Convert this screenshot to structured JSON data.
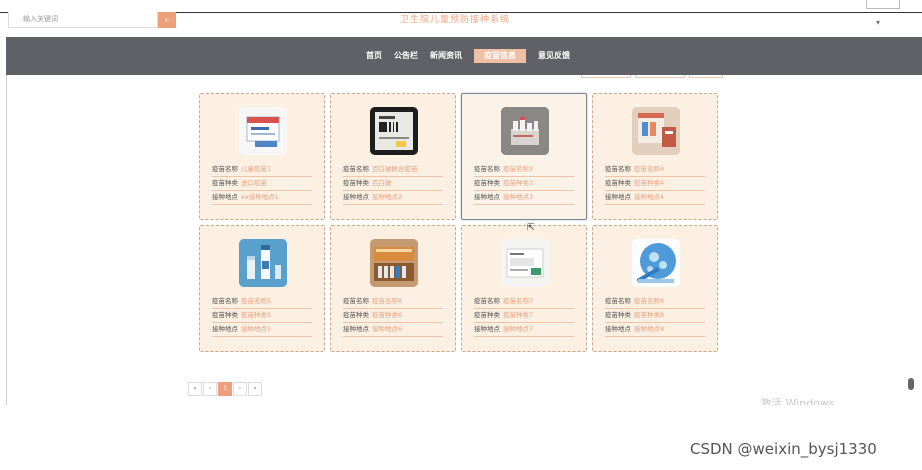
{
  "header": {
    "search_placeholder": "输入关键词",
    "search_button": "搜",
    "site_title": "卫生院儿童预防接种系统"
  },
  "nav": {
    "items": [
      "首页",
      "公告栏",
      "新闻资讯",
      "疫苗信息",
      "意见反馈"
    ],
    "active_index": 3
  },
  "labels": {
    "name": "疫苗名称",
    "type": "疫苗种类",
    "place": "接种地点"
  },
  "cards": [
    {
      "name": "儿童疫苗1",
      "type": "进口疫苗",
      "place": "xx接种地点1",
      "image": "vaccine-box-image"
    },
    {
      "name": "百白破联合疫苗",
      "type": "百白破",
      "place": "接种地点2",
      "image": "vaccine-tablet-image"
    },
    {
      "name": "疫苗名称3",
      "type": "疫苗种类3",
      "place": "接种地点3",
      "image": "vaccine-vials-image"
    },
    {
      "name": "疫苗名称4",
      "type": "疫苗种类4",
      "place": "接种地点4",
      "image": "vaccine-kit-image"
    },
    {
      "name": "疫苗名称5",
      "type": "疫苗种类5",
      "place": "接种地点5",
      "image": "vaccine-bottle-image"
    },
    {
      "name": "疫苗名称6",
      "type": "疫苗种类6",
      "place": "接种地点6",
      "image": "vaccine-tray-image"
    },
    {
      "name": "疫苗名称7",
      "type": "疫苗种类7",
      "place": "接种地点7",
      "image": "vaccine-package-image"
    },
    {
      "name": "疫苗名称8",
      "type": "疫苗种类8",
      "place": "接种地点8",
      "image": "vaccine-globe-image"
    }
  ],
  "pager": {
    "first": "«",
    "prev": "‹",
    "current": "1",
    "next": "›",
    "last": "»"
  },
  "overlay": {
    "windows_watermark": "激活 Windows",
    "csdn_watermark": "CSDN @weixin_bysj1330"
  },
  "colors": {
    "accent": "#eea07d",
    "nav_bg": "#5f6166",
    "card_bg": "#fbf0e2"
  }
}
